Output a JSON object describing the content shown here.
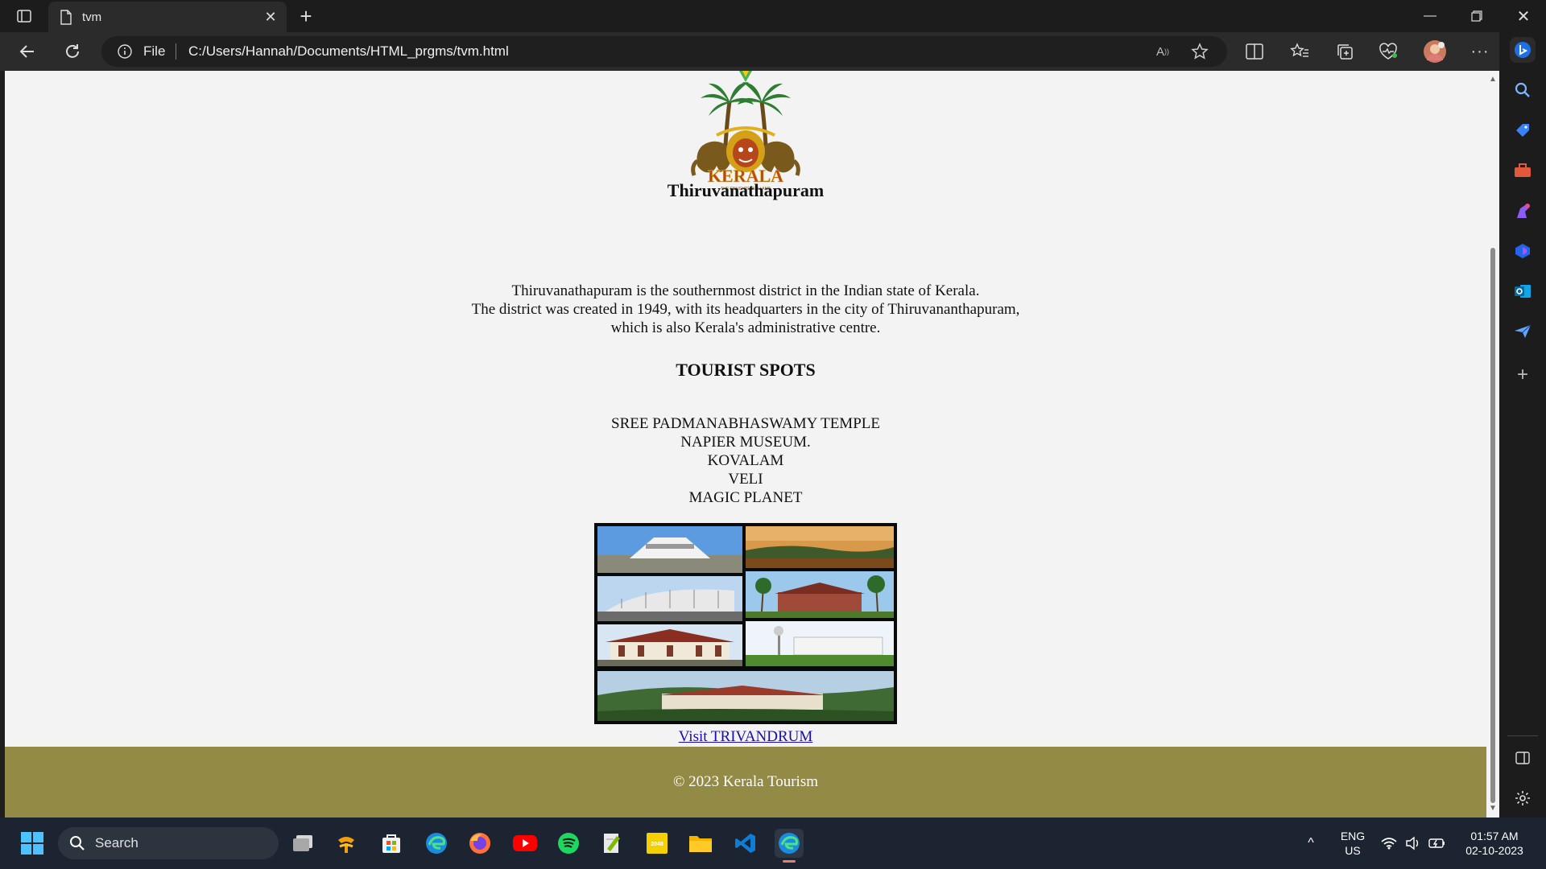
{
  "browser": {
    "tab_title": "tvm",
    "address_scheme": "File",
    "address_url": "C:/Users/Hannah/Documents/HTML_prgms/tvm.html"
  },
  "page": {
    "logo_text": "KERALA",
    "logo_tagline": "THE ENLIGHTENED LAND",
    "title": "Thiruvanathapuram",
    "description_lines": [
      "Thiruvanathapuram is the southernmost district in the Indian state of Kerala.",
      "The district was created in 1949, with its headquarters in the city of Thiruvananthapuram,",
      "which is also Kerala's administrative centre."
    ],
    "tourist_heading": "TOURIST SPOTS",
    "spots": [
      "SREE PADMANABHASWAMY TEMPLE",
      "NAPIER MUSEUM.",
      "KOVALAM",
      "VELI",
      "MAGIC PLANET"
    ],
    "link_text": "Visit TRIVANDRUM",
    "footer_text": "© 2023 Kerala Tourism"
  },
  "taskbar": {
    "search_placeholder": "Search",
    "lang_top": "ENG",
    "lang_bottom": "US",
    "time": "01:57 AM",
    "date": "02-10-2023"
  },
  "colors": {
    "footer_bg": "#938a45",
    "link": "#1a0dab",
    "page_bg": "#f3f3f3"
  }
}
